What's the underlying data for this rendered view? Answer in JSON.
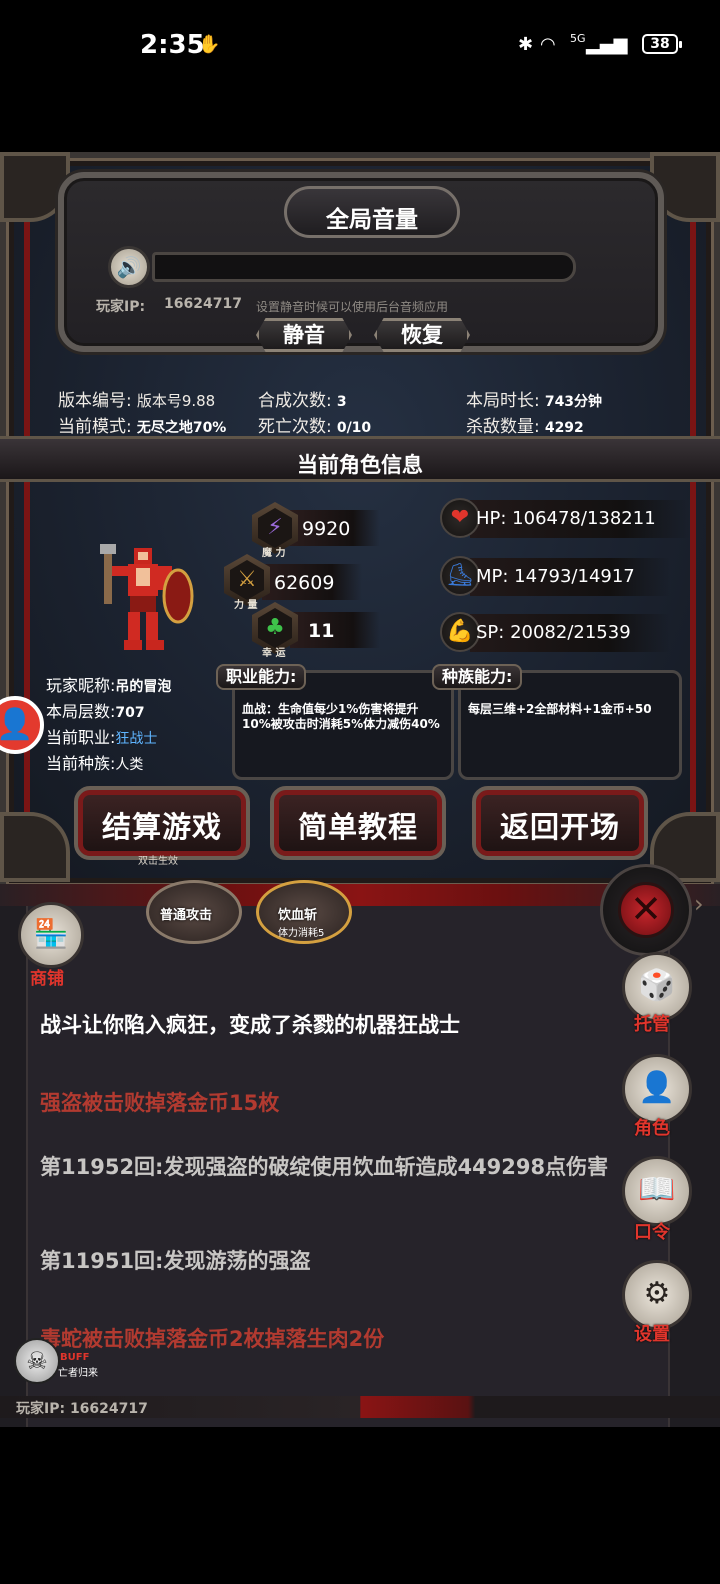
{
  "status_bar": {
    "time": "2:35",
    "signal_icons": [
      "vpn-icon",
      "bluetooth-icon",
      "wifi-icon",
      "signal-5g-icon",
      "signal-icon"
    ],
    "battery": "38"
  },
  "volume_panel": {
    "title": "全局音量",
    "ip_label": "玩家IP:",
    "ip_value": "16624717",
    "hint": "设置静音时候可以使用后台音频应用",
    "mute_label": "静音",
    "restore_label": "恢复"
  },
  "stats": {
    "version_label": "版本编号:",
    "version_value": "版本号9.88",
    "mode_label": "当前模式:",
    "mode_value": "无尽之地70%",
    "merge_label": "合成次数:",
    "merge_value": "3",
    "death_label": "死亡次数:",
    "death_value": "0/10",
    "duration_label": "本局时长:",
    "duration_value": "743分钟",
    "kills_label": "杀敌数量:",
    "kills_value": "4292"
  },
  "character": {
    "section_title": "当前角色信息",
    "magic_caption": "魔 力",
    "magic_value": "9920",
    "strength_caption": "力 量",
    "strength_value": "62609",
    "luck_caption": "幸 运",
    "luck_value": "11",
    "hp": "HP:  106478/138211",
    "mp": "MP:  14793/14917",
    "sp": "SP:  20082/21539",
    "nickname_label": "玩家昵称:",
    "nickname_value": "吊的冒泡",
    "floor_label": "本局层数:",
    "floor_value": "707",
    "class_label": "当前职业:",
    "class_value": "狂战士",
    "race_label": "当前种族:",
    "race_value": "人类",
    "job_ability_tag": "职业能力:",
    "job_ability_text": "血战：生命值每少1%伤害将提升10%被攻击时消耗5%体力减伤40%",
    "race_ability_tag": "种族能力:",
    "race_ability_text": "每层三维+2全部材料+1金币+50"
  },
  "buttons": {
    "settle": "结算游戏",
    "settle_sub": "双击生效",
    "tutorial": "简单教程",
    "return": "返回开场"
  },
  "skills": {
    "normal_attack": "普通攻击",
    "blood_slash": "饮血斩",
    "blood_slash_cost": "体力消耗5"
  },
  "side_menu": {
    "shop": "商铺",
    "auto": "托管",
    "role": "角色",
    "code": "口令",
    "settings": "设置"
  },
  "log": [
    {
      "text": "战斗让你陷入疯狂，变成了杀戮的机器狂战士",
      "color": "#ffffff"
    },
    {
      "text": "强盗被击败掉落金币15枚",
      "color": "#b23a30"
    },
    {
      "text": "第11952回:发现强盗的破绽使用饮血斩造成449298点伤害",
      "color": "#c8c6c4"
    },
    {
      "text": "第11951回:发现游荡的强盗",
      "color": "#c8c6c4"
    },
    {
      "text": "毒蛇被击败掉落金币2枚掉落生肉2份",
      "color": "#b23a30"
    }
  ],
  "buff": {
    "label": "BUFF",
    "sub": "亡者归来"
  },
  "bottom_ip": "玩家IP:  16624717"
}
